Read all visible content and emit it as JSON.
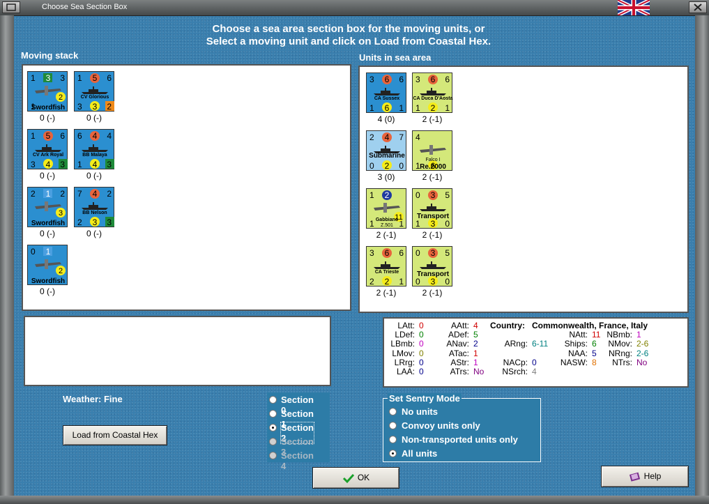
{
  "window": {
    "title": "Choose Sea Section Box"
  },
  "instructions": {
    "line1": "Choose a sea area section box for the moving units, or",
    "line2": "Select a moving unit and click on Load from Coastal Hex."
  },
  "moving_stack": {
    "label": "Moving stack",
    "units": [
      {
        "name": "Swordfish",
        "type": "air",
        "top": [
          "1",
          "3",
          "3"
        ],
        "bottom": [
          "1",
          "",
          ""
        ],
        "badge": "2",
        "caption": "0 (-)",
        "color": "#2b8fd0"
      },
      {
        "name": "CV Glorious",
        "type": "ship",
        "top": [
          "1",
          "5",
          "6"
        ],
        "bottom": [
          "3",
          "3",
          "2"
        ],
        "caption": "0 (-)",
        "color": "#2b8fd0"
      },
      {
        "name": "CV Ark Royal",
        "type": "ship",
        "top": [
          "1",
          "5",
          "6"
        ],
        "bottom": [
          "3",
          "4",
          "3"
        ],
        "caption": "0 (-)",
        "color": "#2b8fd0"
      },
      {
        "name": "BB Malaya",
        "type": "ship",
        "top": [
          "6",
          "4",
          "4"
        ],
        "bottom": [
          "1",
          "4",
          "3"
        ],
        "caption": "0 (-)",
        "color": "#2b8fd0"
      },
      {
        "name": "Swordfish",
        "type": "air",
        "top": [
          "2",
          "1",
          "2"
        ],
        "bottom": [
          "",
          "",
          ""
        ],
        "badge": "3",
        "caption": "0 (-)",
        "color": "#2b8fd0"
      },
      {
        "name": "BB Nelson",
        "type": "ship",
        "top": [
          "7",
          "4",
          "2"
        ],
        "bottom": [
          "2",
          "3",
          "3"
        ],
        "caption": "0 (-)",
        "color": "#2b8fd0"
      },
      {
        "name": "Swordfish",
        "type": "air",
        "top": [
          "0",
          "1",
          ""
        ],
        "bottom": [
          "",
          "",
          ""
        ],
        "badge": "2",
        "caption": "0 (-)",
        "color": "#2b8fd0"
      }
    ]
  },
  "sea_area": {
    "label": "Units in sea area",
    "units": [
      {
        "name": "CA Sussex",
        "type": "ship",
        "top": [
          "3",
          "6",
          "6"
        ],
        "bottom": [
          "1",
          "6",
          "1"
        ],
        "caption": "4 (0)",
        "color": "#2b8fd0"
      },
      {
        "name": "CA Duca D'Aosta",
        "type": "ship",
        "top": [
          "3",
          "6",
          "6"
        ],
        "bottom": [
          "1",
          "2",
          "1"
        ],
        "caption": "2 (-1)",
        "color": "#d4e87a"
      },
      {
        "name": "Submarine",
        "type": "sub",
        "top": [
          "2",
          "4",
          "7"
        ],
        "bottom": [
          "0",
          "2",
          "0"
        ],
        "caption": "3 (0)",
        "color": "#9fd0ef"
      },
      {
        "name": "Re.2000",
        "sub": "Falco I",
        "type": "air",
        "top": [
          "4",
          "",
          ""
        ],
        "bottom": [
          "1",
          "6",
          ""
        ],
        "caption": "2 (-1)",
        "color": "#d4e87a"
      },
      {
        "name": "Gabbiano",
        "sub": "Z.501",
        "type": "seaplane",
        "top": [
          "1",
          "2",
          ""
        ],
        "bottom": [
          "1",
          "",
          "1"
        ],
        "badge": "11",
        "caption": "2 (-1)",
        "color": "#d4e87a"
      },
      {
        "name": "Transport",
        "type": "transport",
        "top": [
          "0",
          "3",
          "5"
        ],
        "bottom": [
          "1",
          "3",
          "0"
        ],
        "caption": "2 (-1)",
        "color": "#d4e87a"
      },
      {
        "name": "CA Trieste",
        "type": "ship",
        "top": [
          "3",
          "6",
          "6"
        ],
        "bottom": [
          "2",
          "2",
          "1"
        ],
        "caption": "2 (-1)",
        "color": "#d4e87a"
      },
      {
        "name": "Transport",
        "type": "transport",
        "top": [
          "0",
          "3",
          "5"
        ],
        "bottom": [
          "0",
          "3",
          "0"
        ],
        "caption": "2 (-1)",
        "color": "#d4e87a"
      }
    ]
  },
  "stats": {
    "country_label": "Country:",
    "country_value": "Commonwealth, France, Italy",
    "rows": [
      {
        "label": "LAtt:",
        "value": "0",
        "color": "#d00000"
      },
      {
        "label": "LDef:",
        "value": "0",
        "color": "#008000"
      },
      {
        "label": "LBmb:",
        "value": "0",
        "color": "#c000c0"
      },
      {
        "label": "LMov:",
        "value": "0",
        "color": "#808000"
      },
      {
        "label": "LRrg:",
        "value": "0",
        "color": "#00008b"
      },
      {
        "label": "LAA:",
        "value": "0",
        "color": "#00008b"
      },
      {
        "label": "AAtt:",
        "value": "4",
        "color": "#d00000"
      },
      {
        "label": "ADef:",
        "value": "5",
        "color": "#008000"
      },
      {
        "label": "ANav:",
        "value": "2",
        "color": "#00008b"
      },
      {
        "label": "ATac:",
        "value": "1",
        "color": "#d00000"
      },
      {
        "label": "AStr:",
        "value": "1",
        "color": "#c000c0"
      },
      {
        "label": "ATrs:",
        "value": "No",
        "color": "#800080"
      },
      {
        "label": "ARng:",
        "value": "6-11",
        "color": "#008080"
      },
      {
        "label": "NACp:",
        "value": "0",
        "color": "#00008b"
      },
      {
        "label": "NSrch:",
        "value": "4",
        "color": "#808080"
      },
      {
        "label": "NAtt:",
        "value": "11",
        "color": "#d00000"
      },
      {
        "label": "Ships:",
        "value": "6",
        "color": "#008000"
      },
      {
        "label": "NAA:",
        "value": "5",
        "color": "#00008b"
      },
      {
        "label": "NASW:",
        "value": "8",
        "color": "#e07000"
      },
      {
        "label": "NBmb:",
        "value": "1",
        "color": "#c000c0"
      },
      {
        "label": "NMov:",
        "value": "2-6",
        "color": "#808000"
      },
      {
        "label": "NRng:",
        "value": "2-6",
        "color": "#008080"
      },
      {
        "label": "NTrs:",
        "value": "No",
        "color": "#800080"
      }
    ]
  },
  "weather": "Weather: Fine",
  "buttons": {
    "load": "Load from Coastal Hex",
    "ok": "OK",
    "help": "Help"
  },
  "sections": [
    {
      "label": "Section 0",
      "selected": false,
      "enabled": true
    },
    {
      "label": "Section 1",
      "selected": false,
      "enabled": true
    },
    {
      "label": "Section 2",
      "selected": true,
      "enabled": true
    },
    {
      "label": "Section 3",
      "selected": false,
      "enabled": false
    },
    {
      "label": "Section 4",
      "selected": false,
      "enabled": false
    }
  ],
  "sentry": {
    "title": "Set Sentry Mode",
    "options": [
      {
        "label": "No units",
        "selected": false
      },
      {
        "label": "Convoy units only",
        "selected": false
      },
      {
        "label": "Non-transported units only",
        "selected": false
      },
      {
        "label": "All units",
        "selected": true
      }
    ]
  }
}
